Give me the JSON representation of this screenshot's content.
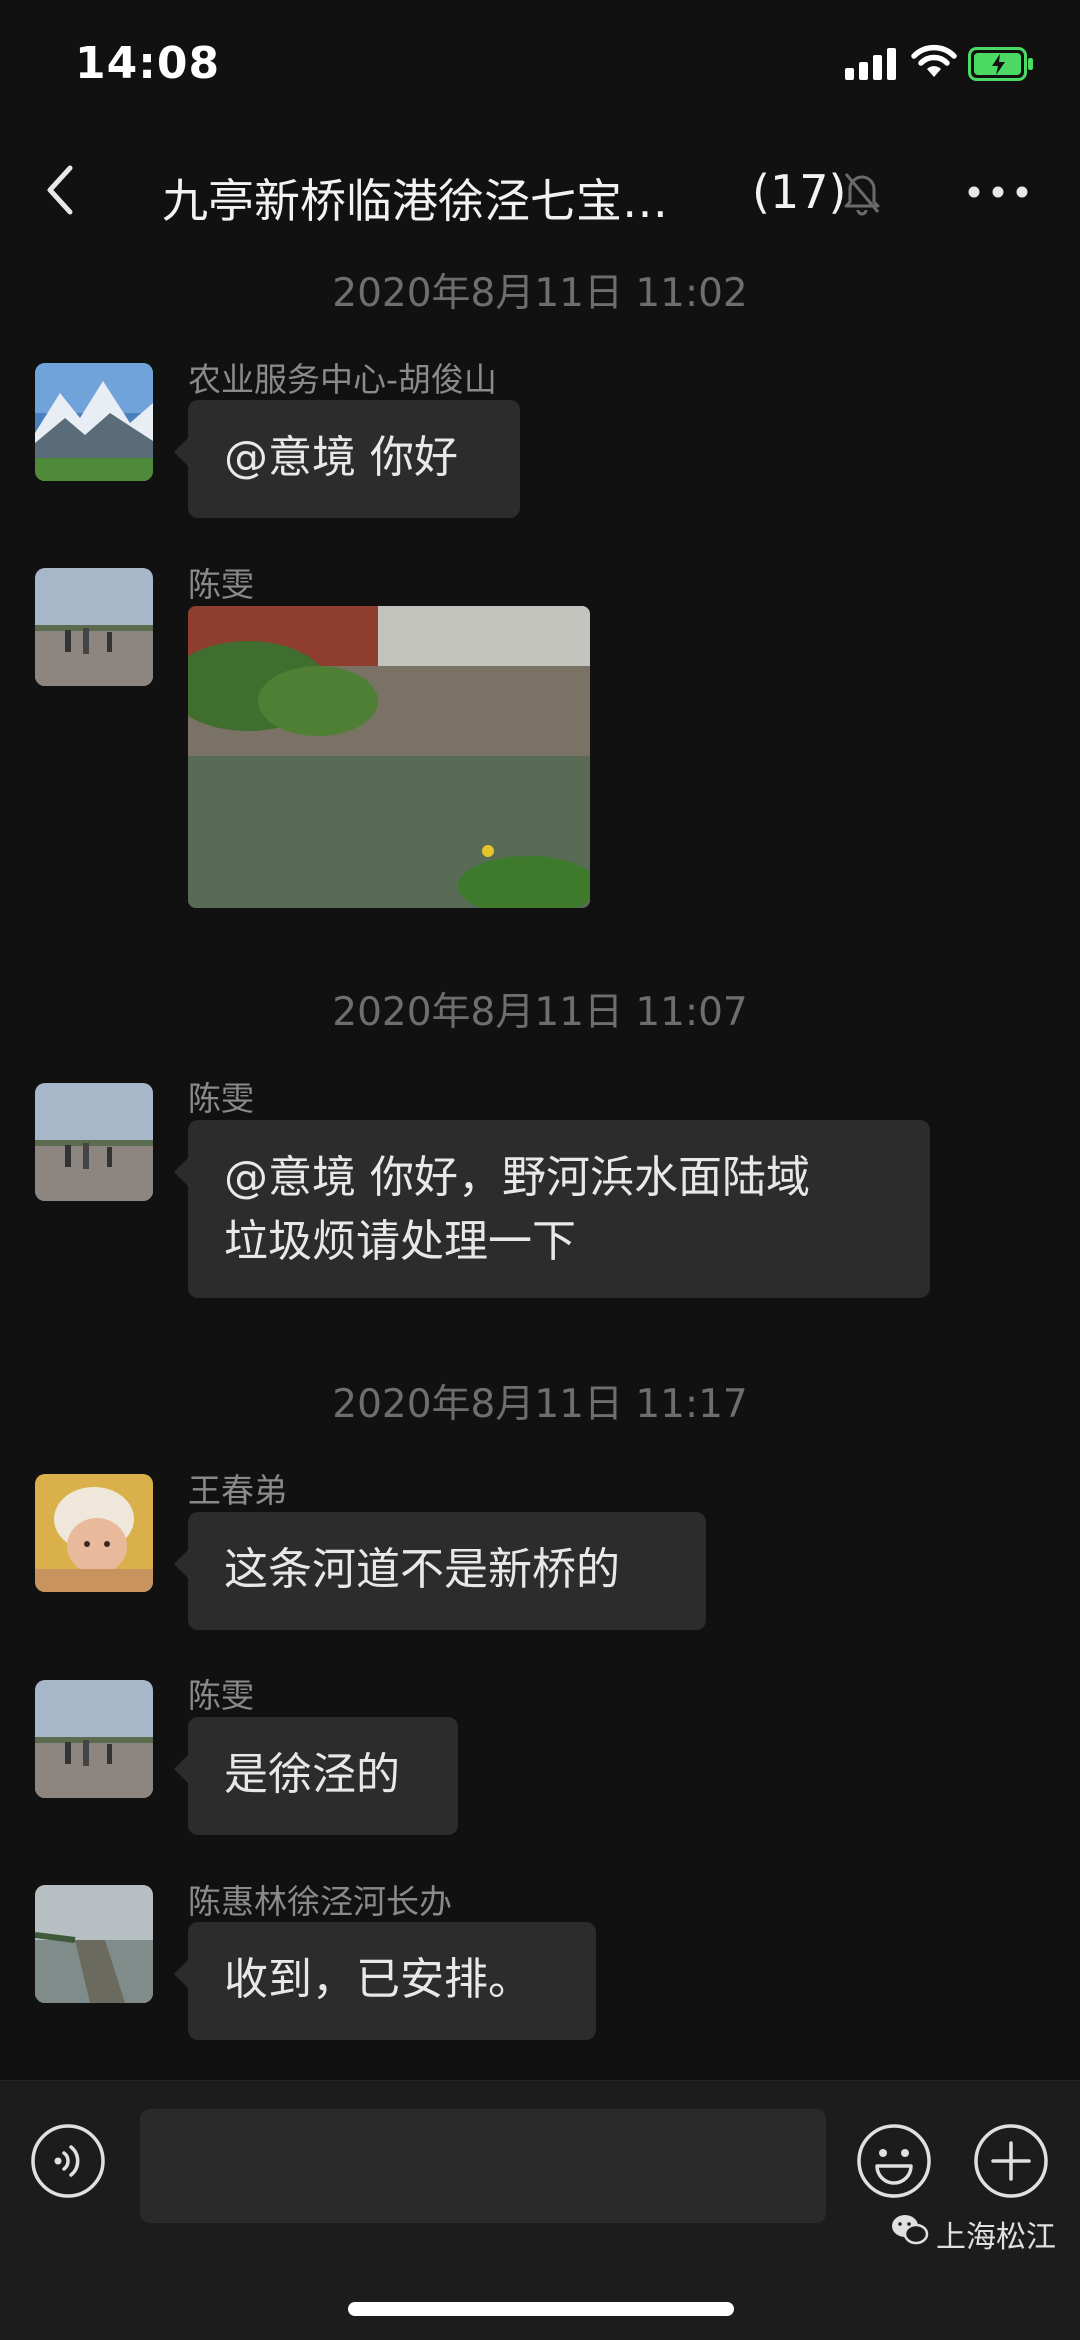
{
  "status": {
    "time": "14:08"
  },
  "header": {
    "title": "九亭新桥临港徐泾七宝…",
    "member_count": "(17)"
  },
  "messages": [
    {
      "timestamp": "2020年8月11日 11:02"
    },
    {
      "sender": "农业服务中心-胡俊山",
      "text": "@意境 你好"
    },
    {
      "sender": "陈雯"
    },
    {
      "timestamp": "2020年8月11日 11:07"
    },
    {
      "sender": "陈雯",
      "text_line1": "@意境  你好，野河浜水面陆域",
      "text_line2": "垃圾烦请处理一下"
    },
    {
      "timestamp": "2020年8月11日 11:17"
    },
    {
      "sender": "王春弟",
      "text": "这条河道不是新桥的"
    },
    {
      "sender": "陈雯",
      "text": "是徐泾的"
    },
    {
      "sender": "陈惠林徐泾河长办",
      "text": "收到，已安排。"
    }
  ],
  "input": {
    "value": ""
  },
  "watermark": {
    "text": "上海松江"
  },
  "colors": {
    "background": "#111111",
    "bubble": "#2c2c2c",
    "battery": "#4cd964"
  },
  "icons": [
    "back-icon",
    "mute-icon",
    "more-icon",
    "voice-icon",
    "emoji-icon",
    "plus-icon",
    "wechat-icon"
  ]
}
